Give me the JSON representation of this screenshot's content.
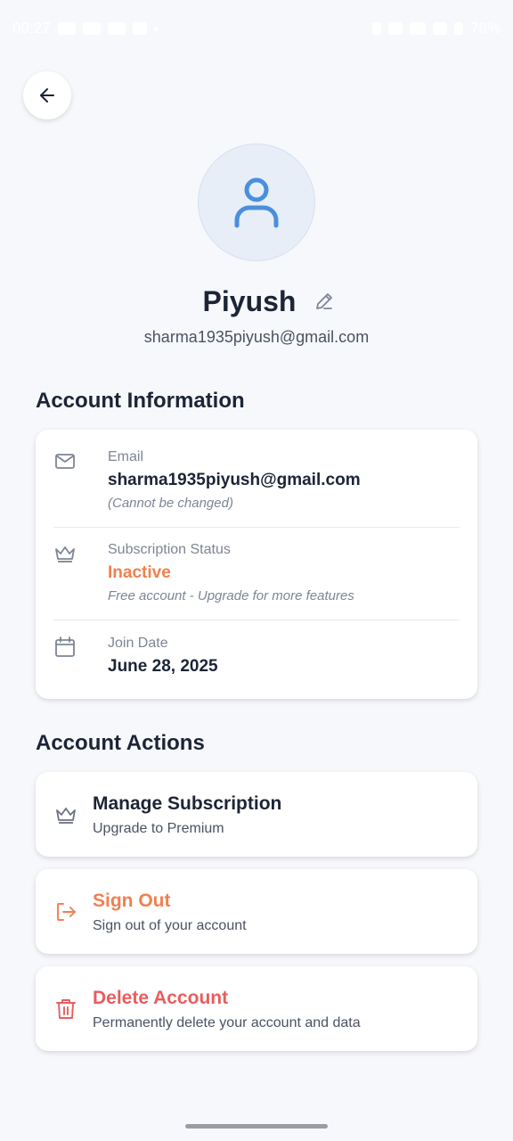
{
  "status_bar": {
    "time": "00:27",
    "battery": "78%"
  },
  "profile": {
    "name": "Piyush",
    "email": "sharma1935piyush@gmail.com"
  },
  "account_information": {
    "title": "Account Information",
    "email": {
      "label": "Email",
      "value": "sharma1935piyush@gmail.com",
      "note": "(Cannot be changed)",
      "icon": "mail-icon"
    },
    "subscription": {
      "label": "Subscription Status",
      "value": "Inactive",
      "note": "Free account - Upgrade for more features",
      "icon": "crown-icon"
    },
    "join_date": {
      "label": "Join Date",
      "value": "June 28, 2025",
      "icon": "calendar-icon"
    }
  },
  "account_actions": {
    "title": "Account Actions",
    "manage_subscription": {
      "title": "Manage Subscription",
      "subtitle": "Upgrade to Premium",
      "icon": "crown-icon"
    },
    "sign_out": {
      "title": "Sign Out",
      "subtitle": "Sign out of your account",
      "icon": "logout-icon"
    },
    "delete_account": {
      "title": "Delete Account",
      "subtitle": "Permanently delete your account and data",
      "icon": "trash-icon"
    }
  },
  "colors": {
    "background": "#f7f8fb",
    "text_primary": "#1c2436",
    "text_secondary": "#7d8594",
    "accent_orange": "#f0804f",
    "danger_red": "#e85d5d",
    "avatar_blue": "#4a8fdf"
  }
}
